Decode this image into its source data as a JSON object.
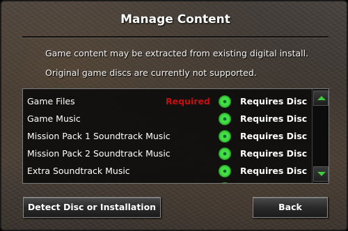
{
  "dialog": {
    "title": "Manage Content",
    "description_line1": "Game content may be extracted from existing digital install.",
    "description_line2": "Original game discs are currently not supported."
  },
  "content_list": {
    "items": [
      {
        "name": "Game Files",
        "tag": "Required",
        "status": "Requires Disc"
      },
      {
        "name": "Game Music",
        "tag": "",
        "status": "Requires Disc"
      },
      {
        "name": "Mission Pack 1 Soundtrack Music",
        "tag": "",
        "status": "Requires Disc"
      },
      {
        "name": "Mission Pack 2 Soundtrack Music",
        "tag": "",
        "status": "Requires Disc"
      },
      {
        "name": "Extra Soundtrack Music",
        "tag": "",
        "status": "Requires Disc"
      }
    ],
    "status_icon": "green-disc-icon",
    "tag_color": "#c80f0f",
    "icon_color": "#3ddc3d"
  },
  "buttons": {
    "detect_label": "Detect Disc or Installation",
    "back_label": "Back"
  }
}
